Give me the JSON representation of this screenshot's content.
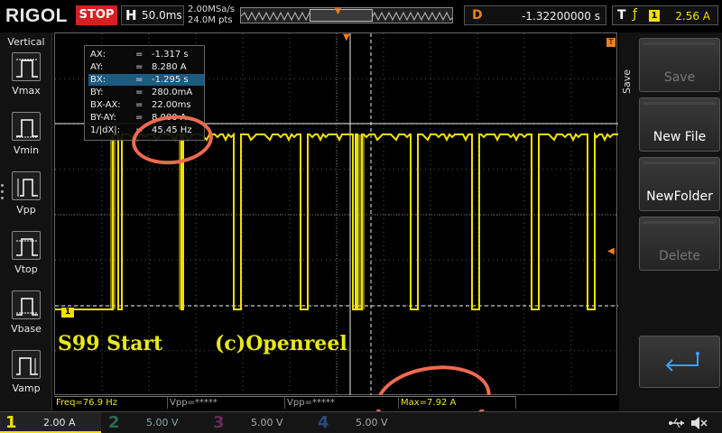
{
  "topbar": {
    "brand": "RIGOL",
    "run_state": "STOP",
    "timebase_label": "H",
    "timebase_value": "50.0ms",
    "sample_rate": "2.00MSa/s",
    "mem_depth": "24.0M pts",
    "delay_label": "D",
    "delay_value": "-1.32200000 s",
    "trigger_label": "T",
    "trigger_channel": "1",
    "trigger_level": "2.56 A"
  },
  "left_menu": {
    "title": "Vertical",
    "items": [
      {
        "label": "Vmax",
        "icon": "vmax-icon"
      },
      {
        "label": "Vmin",
        "icon": "vmin-icon"
      },
      {
        "label": "Vpp",
        "icon": "vpp-icon"
      },
      {
        "label": "Vtop",
        "icon": "vtop-icon"
      },
      {
        "label": "Vbase",
        "icon": "vbase-icon"
      },
      {
        "label": "Vamp",
        "icon": "vamp-icon"
      }
    ]
  },
  "cursor_table": {
    "rows": [
      {
        "key": "AX:",
        "value": "-1.317 s"
      },
      {
        "key": "AY:",
        "value": "8.280 A"
      },
      {
        "key": "BX:",
        "value": "-1.295 s"
      },
      {
        "key": "BY:",
        "value": "280.0mA"
      },
      {
        "key": "BX-AX:",
        "value": "22.00ms"
      },
      {
        "key": "BY-AY:",
        "value": "8.000 A"
      },
      {
        "key": "1/|dX|:",
        "value": "45.45 Hz"
      }
    ],
    "separator": "="
  },
  "channel1_marker": "1",
  "watermark_left": "S99 Start",
  "watermark_right": "(c)Openreel",
  "right_menu": {
    "title": "Save",
    "buttons": [
      {
        "label": "Save",
        "enabled": false
      },
      {
        "label": "New File",
        "enabled": true
      },
      {
        "label": "NewFolder",
        "enabled": true
      },
      {
        "label": "Delete",
        "enabled": false
      }
    ]
  },
  "measurements": [
    {
      "text": "Freq=76.9 Hz"
    },
    {
      "text": "Vpp=*****"
    },
    {
      "text": "Vpp=*****"
    },
    {
      "text": "Max=7.92 A"
    }
  ],
  "channels": [
    {
      "num": "1",
      "scale": "2.00 A"
    },
    {
      "num": "2",
      "scale": "5.00 V"
    },
    {
      "num": "3",
      "scale": "5.00 V"
    },
    {
      "num": "4",
      "scale": "5.00 V"
    }
  ],
  "colors": {
    "ch1": "#f0e000",
    "accent_orange": "#f08020",
    "stop_red": "#d42020",
    "annotation": "#ee6a50"
  }
}
